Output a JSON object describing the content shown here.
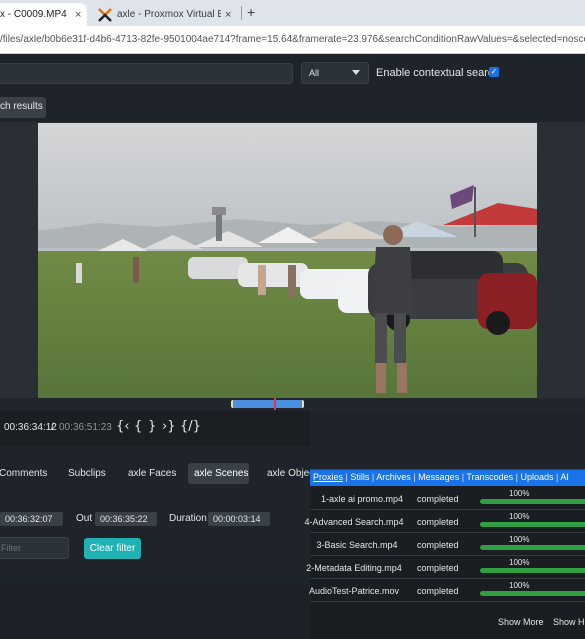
{
  "browser": {
    "tabs": [
      {
        "label": "x - C0009.MP4",
        "active": true
      },
      {
        "label": "axle - Proxmox Virtual Environm",
        "active": false
      }
    ],
    "close_glyph": "×",
    "new_tab_glyph": "+",
    "url": "/files/axle/b0b6e31f-d4b6-4713-82fe-9501004ae714?frame=15.64&framerate=23.976&searchConditionRawValues=&selected=noscosScenes"
  },
  "search": {
    "scope_selected": "All",
    "contextual_label": "Enable contextual search",
    "contextual_checked": true,
    "results_button": "ch results"
  },
  "player": {
    "timecode_current": "00:36:34:12",
    "timecode_separator": "/",
    "timecode_total": "00:36:51:23",
    "scrub_range": [
      0.395,
      0.52
    ],
    "playhead": 0.468,
    "controls": [
      "{‹",
      "{",
      "}",
      "›}",
      "{/}"
    ]
  },
  "subtabs": {
    "comments": "Comments",
    "subclips": "Subclips",
    "faces": "axle Faces",
    "scenes": "axle Scenes",
    "objects": "axle Objec"
  },
  "timing": {
    "in_value": "00:36:32:07",
    "out_label": "Out",
    "out_value": "00:36:35:22",
    "duration_label": "Duration",
    "duration_value": "00:00:03:14"
  },
  "filter": {
    "placeholder": "Filter",
    "clear_label": "Clear filter"
  },
  "jobs": {
    "tabs": [
      "Proxies",
      "Stills",
      "Archives",
      "Messages",
      "Transcodes",
      "Uploads",
      "AI"
    ],
    "tab_separator": "|",
    "rows": [
      {
        "name": "1-axle ai promo.mp4",
        "status": "completed",
        "percent": "100%",
        "progress": 1.0
      },
      {
        "name": "4-Advanced Search.mp4",
        "status": "completed",
        "percent": "100%",
        "progress": 1.0
      },
      {
        "name": "3-Basic Search.mp4",
        "status": "completed",
        "percent": "100%",
        "progress": 1.0
      },
      {
        "name": "2-Metadata Editing.mp4",
        "status": "completed",
        "percent": "100%",
        "progress": 1.0
      },
      {
        "name": "AudioTest-Patrice.mov",
        "status": "completed",
        "percent": "100%",
        "progress": 1.0
      }
    ],
    "show_more": "Show More",
    "show_history": "Show His"
  },
  "colors": {
    "accent": "#1a73e8",
    "clear_button": "#1fb1b3",
    "progress": "#2ea043",
    "playhead": "#e0334c"
  }
}
